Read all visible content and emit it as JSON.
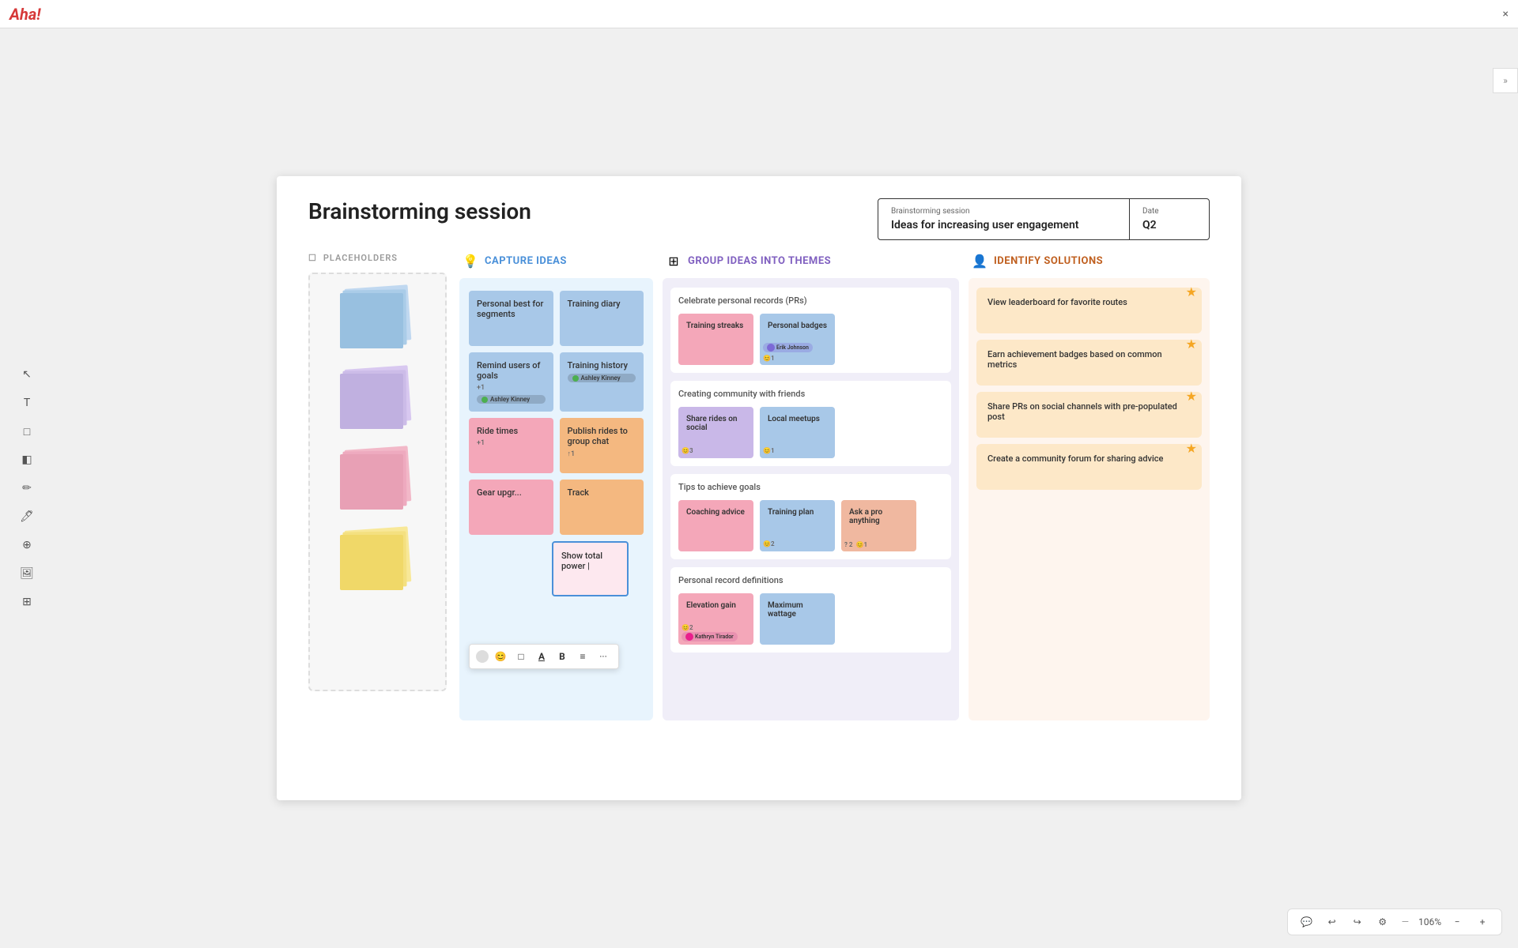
{
  "app": {
    "title": "Aha!",
    "close": "×"
  },
  "header": {
    "page_title": "Brainstorming session",
    "session_label": "Brainstorming session",
    "session_value": "Ideas for increasing user engagement",
    "date_label": "Date",
    "date_value": "Q2"
  },
  "placeholders": {
    "header": "PLACEHOLDERS",
    "stacks": [
      "blue",
      "purple",
      "pink",
      "yellow"
    ]
  },
  "capture": {
    "header": "CAPTURE IDEAS",
    "icon": "💡",
    "notes": [
      {
        "text": "Personal best for segments",
        "color": "blue"
      },
      {
        "text": "Training diary",
        "color": "blue"
      },
      {
        "text": "Remind users of goals",
        "color": "blue",
        "user": "Ashley Kinney",
        "badge": "+1"
      },
      {
        "text": "Training history",
        "color": "blue",
        "user": "Ashley Kinney"
      },
      {
        "text": "Ride times",
        "color": "pink",
        "badge": "+1"
      },
      {
        "text": "Publish rides to group chat",
        "color": "coral",
        "badge": "↑1"
      },
      {
        "text": "Gear upgr...",
        "color": "pink"
      },
      {
        "text": "Track",
        "color": "coral"
      },
      {
        "text": "Show total power |",
        "color": "editing"
      }
    ]
  },
  "format_toolbar": {
    "circle": "○",
    "emoji": "😊",
    "box": "□",
    "text_a": "A",
    "bold_b": "B",
    "list": "≡",
    "more": "···"
  },
  "group": {
    "header": "GROUP IDEAS INTO THEMES",
    "icon": "⊞",
    "themes": [
      {
        "title": "Celebrate personal records (PRs)",
        "notes": [
          {
            "text": "Training streaks",
            "color": "pink"
          },
          {
            "text": "Personal badges",
            "color": "blue",
            "badge": "😊1",
            "user": "Erik Johnson",
            "user_color": "purple"
          }
        ]
      },
      {
        "title": "Creating community with friends",
        "notes": [
          {
            "text": "Share rides on social",
            "color": "purple",
            "badge": "😊3"
          },
          {
            "text": "Local meetups",
            "color": "blue",
            "badge": "😊1"
          }
        ]
      },
      {
        "title": "Tips to achieve goals",
        "notes": [
          {
            "text": "Coaching advice",
            "color": "pink"
          },
          {
            "text": "Training plan",
            "color": "blue",
            "badge": "😊2"
          },
          {
            "text": "Ask a pro anything",
            "color": "coral",
            "badge": "?2",
            "badge2": "😊1"
          }
        ]
      },
      {
        "title": "Personal record definitions",
        "notes": [
          {
            "text": "Elevation gain",
            "color": "pink",
            "badge": "😊2",
            "user": "Kathryn Tirador",
            "user_color": "pink"
          },
          {
            "text": "Maximum wattage",
            "color": "blue"
          }
        ]
      }
    ]
  },
  "solutions": {
    "header": "IDENTIFY SOLUTIONS",
    "icon": "👤",
    "cards": [
      {
        "text": "View leaderboard for favorite routes",
        "has_star": true
      },
      {
        "text": "Earn achievement badges based on common metrics",
        "has_star": true
      },
      {
        "text": "Share PRs on social channels with pre-populated post",
        "has_star": true
      },
      {
        "text": "Create a community forum for sharing advice",
        "has_star": true
      }
    ]
  },
  "toolbar": {
    "zoom": "106%",
    "comment": "💬",
    "undo": "↩",
    "redo": "↪",
    "settings": "⚙"
  }
}
